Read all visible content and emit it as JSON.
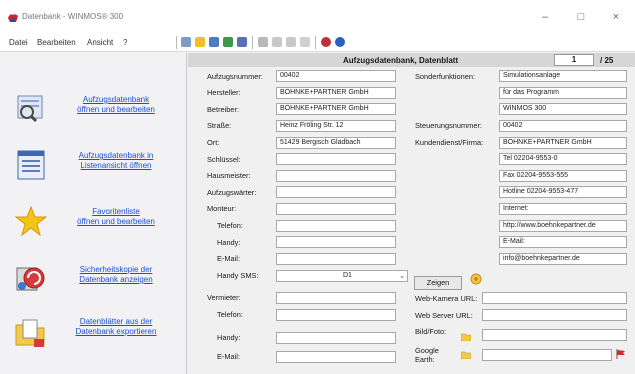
{
  "window": {
    "title": "Datenbank - WINMOS® 300"
  },
  "menu": {
    "items": [
      "Datei",
      "Bearbeiten",
      "Ansicht",
      "?"
    ]
  },
  "sidebar": {
    "items": [
      {
        "label_line1": "Aufzugsdatenbank",
        "label_line2": "öffnen und bearbeiten"
      },
      {
        "label_line1": "Aufzugsdatenbank in",
        "label_line2": "Listenansicht öffnen"
      },
      {
        "label_line1": "Favoritenliste",
        "label_line2": "öffnen und bearbeiten"
      },
      {
        "label_line1": "Sicherheitskopie der",
        "label_line2": "Datenbank anzeigen"
      },
      {
        "label_line1": "Datenblätter aus der",
        "label_line2": "Datenbank exportieren"
      }
    ]
  },
  "form": {
    "title": "Aufzugsdatenbank, Datenblatt",
    "page_current": "1",
    "page_total": "/ 25",
    "left": [
      {
        "label": "Aufzugsnummer:",
        "value": "00402"
      },
      {
        "label": "Hersteller:",
        "value": "BÖHNKE+PARTNER GmbH"
      },
      {
        "label": "Betreiber:",
        "value": "BÖHNKE+PARTNER GmbH"
      },
      {
        "label": "Straße:",
        "value": "Heinz Fröling Str. 12"
      },
      {
        "label": "Ort:",
        "value": "51429 Bergisch Gladbach"
      },
      {
        "label": "Schlüssel:",
        "value": ""
      },
      {
        "label": "Hausmeister:",
        "value": ""
      },
      {
        "label": "Aufzugswärter:",
        "value": ""
      },
      {
        "label": "Monteur:",
        "value": ""
      },
      {
        "label": "Telefon:",
        "value": ""
      },
      {
        "label": "Handy:",
        "value": ""
      },
      {
        "label": "E-Mail:",
        "value": ""
      },
      {
        "label": "Handy SMS:",
        "value": "D1"
      },
      {
        "label": "Vermieter:",
        "value": ""
      },
      {
        "label": "Telefon:",
        "value": ""
      },
      {
        "label": "Handy:",
        "value": ""
      },
      {
        "label": "E-Mail:",
        "value": ""
      }
    ],
    "right": [
      {
        "label": "Sonderfunktionen:",
        "value": "Simulationsanlage"
      },
      {
        "label": "",
        "value": "für das Programm"
      },
      {
        "label": "",
        "value": "WINMOS 300"
      },
      {
        "label": "Steuerungsnummer:",
        "value": "00402"
      },
      {
        "label": "Kundendienst/Firma:",
        "value": "BÖHNKE+PARTNER GmbH"
      },
      {
        "label": "",
        "value": "Tel 02204-9553-0"
      },
      {
        "label": "",
        "value": "Fax 02204-9553-555"
      },
      {
        "label": "",
        "value": "Hotline 02204-9553-477"
      },
      {
        "label": "",
        "value": "Internet:"
      },
      {
        "label": "",
        "value": "http://www.boehnkepartner.de"
      },
      {
        "label": "",
        "value": "E-Mail:"
      },
      {
        "label": "",
        "value": "info@boehnkepartner.de"
      }
    ],
    "zeigen_button": "Zeigen",
    "webcam_label": "Web-Kamera URL:",
    "webserver_label": "Web Server URL:",
    "bild_label": "Bild/Foto:",
    "google_label_line1": "Google",
    "google_label_line2": "Earth:"
  }
}
